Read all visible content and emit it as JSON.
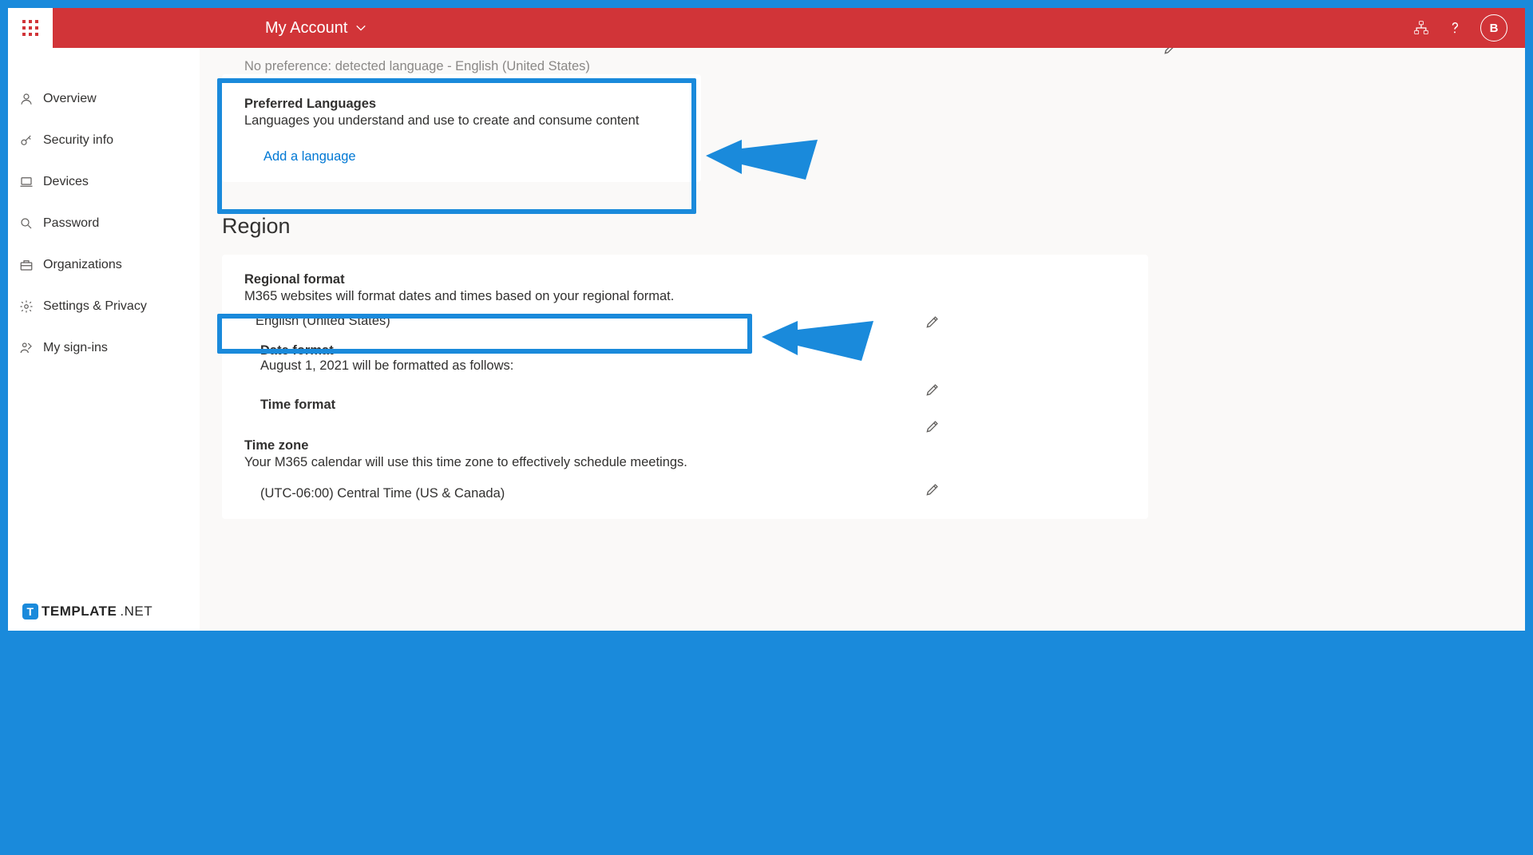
{
  "header": {
    "account_label": "My Account",
    "avatar_initial": "B"
  },
  "sidebar": {
    "items": [
      {
        "label": "Overview"
      },
      {
        "label": "Security info"
      },
      {
        "label": "Devices"
      },
      {
        "label": "Password"
      },
      {
        "label": "Organizations"
      },
      {
        "label": "Settings & Privacy"
      },
      {
        "label": "My sign-ins"
      }
    ]
  },
  "language": {
    "no_pref_text": "No preference: detected language - English (United States)",
    "pref_title": "Preferred Languages",
    "pref_desc": "Languages you understand and use to create and consume content",
    "add_link": "Add a language"
  },
  "region": {
    "section_title": "Region",
    "format_title": "Regional format",
    "format_desc": "M365 websites will format dates and times based on your regional format.",
    "format_value": "English (United States)",
    "date_title": "Date format",
    "date_desc": "August 1, 2021 will be formatted as follows:",
    "time_title": "Time format",
    "tz_title": "Time zone",
    "tz_desc": "Your M365 calendar will use this time zone to effectively schedule meetings.",
    "tz_value": "(UTC-06:00) Central Time (US & Canada)"
  },
  "watermark": {
    "brand_main": "TEMPLATE",
    "brand_suffix": ".NET"
  }
}
